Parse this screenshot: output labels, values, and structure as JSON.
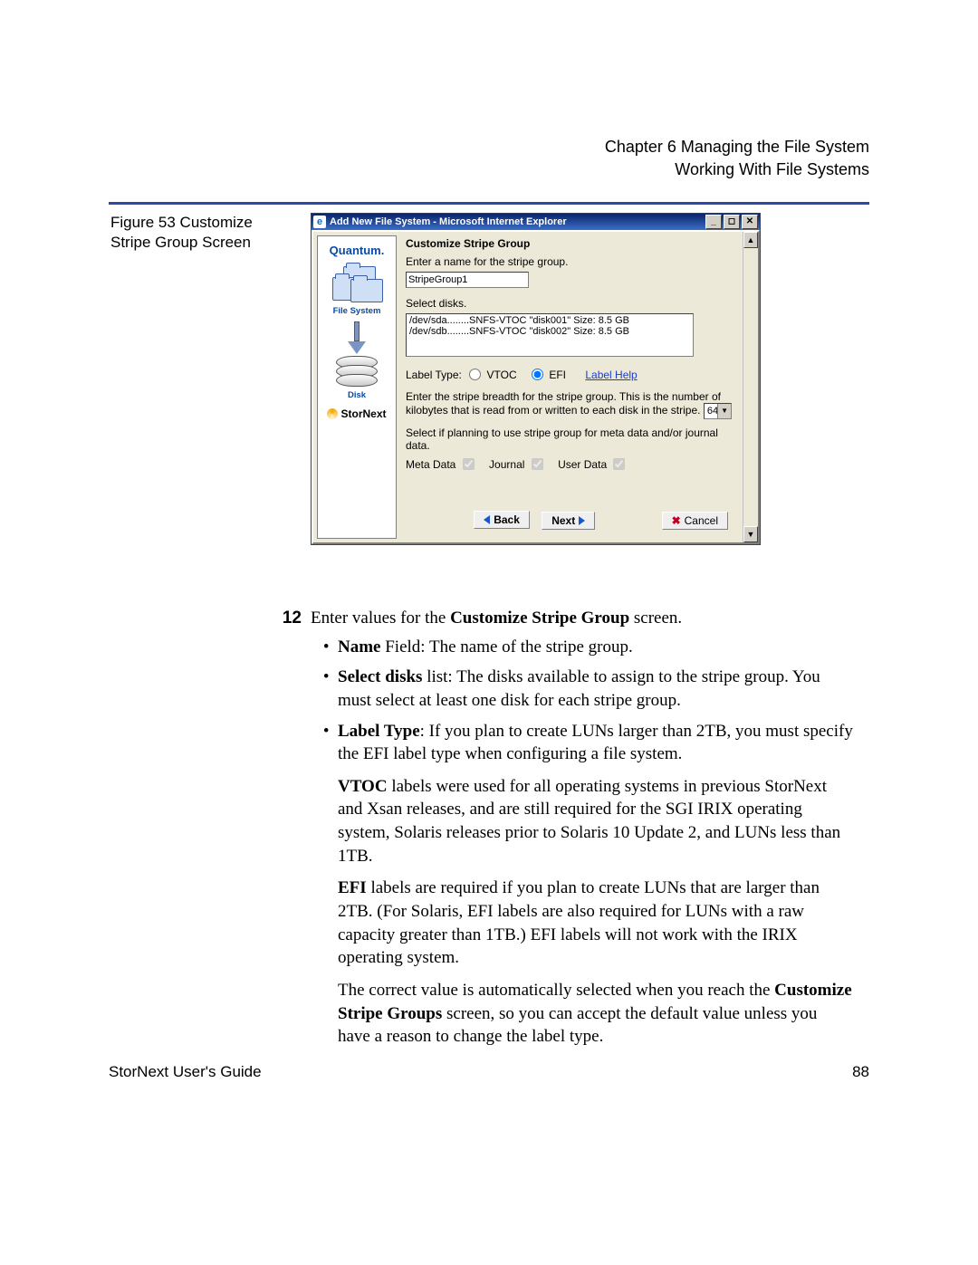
{
  "header": {
    "line1": "Chapter 6  Managing the File System",
    "line2": "Working With File Systems"
  },
  "figure_caption": "Figure 53  Customize Stripe Group Screen",
  "ie": {
    "title": "Add New File System - Microsoft Internet Explorer",
    "panel_title": "Customize Stripe Group",
    "name_prompt": "Enter a name for the stripe group.",
    "name_value": "StripeGroup1",
    "select_disks_label": "Select disks.",
    "disks": [
      "/dev/sda........SNFS-VTOC \"disk001\" Size: 8.5 GB",
      "/dev/sdb........SNFS-VTOC \"disk002\" Size: 8.5 GB"
    ],
    "label_type_label": "Label Type:",
    "vtoc": "VTOC",
    "efi": "EFI",
    "label_help": "Label Help",
    "breadth_prompt_a": "Enter the stripe breadth for the stripe group. This is the number of kilobytes that is read from or written to each disk in the stripe.",
    "breadth_value": "64",
    "usage_prompt": "Select if planning to use stripe group for meta data and/or journal data.",
    "meta": "Meta Data",
    "journal": "Journal",
    "user": "User Data",
    "sidebar": {
      "brand": "Quantum.",
      "fs": "File System",
      "disk": "Disk",
      "product": "StorNext"
    },
    "buttons": {
      "back": "Back",
      "next": "Next",
      "cancel": "Cancel"
    }
  },
  "step": {
    "num": "12",
    "intro_a": "Enter values for the ",
    "intro_bold": "Customize Stripe Group",
    "intro_b": " screen.",
    "name_bold": "Name",
    "name_rest": " Field: The name of the stripe group.",
    "sd_bold": "Select disks",
    "sd_rest": " list: The disks available to assign to the stripe group. You must select at least one disk for each stripe group.",
    "lt_bold": "Label Type",
    "lt_rest": ": If you plan to create LUNs larger than 2TB, you must specify the EFI label type when configuring a file system.",
    "vtoc_p_a": "VTOC",
    "vtoc_p_rest": " labels were used for all operating systems in previous StorNext and Xsan releases, and are still required for the SGI IRIX operating system, Solaris releases prior to Solaris 10 Update 2, and LUNs less than 1TB.",
    "efi_p_a": "EFI",
    "efi_p_rest": " labels are required if you plan to create LUNs that are larger than 2TB. (For Solaris, EFI labels are also required for LUNs with a raw capacity greater than 1TB.) EFI labels will not work with the IRIX operating system.",
    "auto_a": "The correct value is automatically selected when you reach the ",
    "auto_bold": "Customize Stripe Groups",
    "auto_b": " screen, so you can accept the default value unless you have a reason to change the label type."
  },
  "footer": {
    "left": "StorNext User's Guide",
    "right": "88"
  }
}
